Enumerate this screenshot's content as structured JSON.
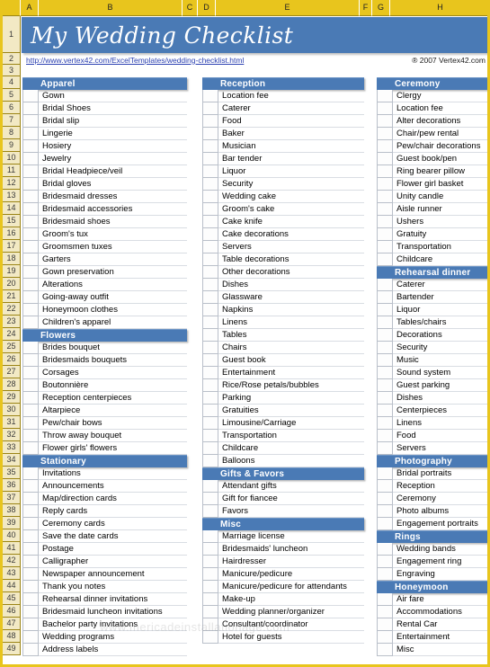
{
  "spreadsheet": {
    "column_headers": [
      {
        "label": "",
        "width": 20
      },
      {
        "label": "A",
        "width": 20
      },
      {
        "label": "B",
        "width": 160
      },
      {
        "label": "C",
        "width": 17
      },
      {
        "label": "D",
        "width": 20
      },
      {
        "label": "E",
        "width": 160
      },
      {
        "label": "F",
        "width": 14
      },
      {
        "label": "G",
        "width": 20
      },
      {
        "label": "H",
        "width": 112
      }
    ],
    "row_numbers": [
      1,
      2,
      3,
      4,
      5,
      6,
      7,
      8,
      9,
      10,
      11,
      12,
      13,
      14,
      15,
      16,
      17,
      18,
      19,
      20,
      21,
      22,
      23,
      24,
      25,
      26,
      27,
      28,
      29,
      30,
      31,
      32,
      33,
      34,
      35,
      36,
      37,
      38,
      39,
      40,
      41,
      42,
      43,
      44,
      45,
      46,
      47,
      48,
      49
    ],
    "colors": {
      "header_fill": "#e8c51d",
      "section_blue": "#4a7ab5",
      "row_header_fill": "#f2e9c4",
      "link_blue": "#2a3fb0"
    }
  },
  "title": "My Wedding Checklist",
  "link": "http://www.vertex42.com/ExcelTemplates/wedding-checklist.html",
  "copyright": "® 2007 Vertex42.com",
  "watermark": "www.mericadeinstallationage.com",
  "columns": [
    {
      "name": "column-left",
      "blocks": [
        {
          "type": "section",
          "label": "Apparel"
        },
        {
          "type": "items",
          "items": [
            "Gown",
            "Bridal Shoes",
            "Bridal slip",
            "Lingerie",
            "Hosiery",
            "Jewelry",
            "Bridal Headpiece/veil",
            "Bridal gloves",
            "Bridesmaid dresses",
            "Bridesmaid accessories",
            "Bridesmaid shoes",
            "Groom's tux",
            "Groomsmen tuxes",
            "Garters",
            "Gown preservation",
            "Alterations",
            "Going-away outfit",
            "Honeymoon clothes",
            "Children's apparel"
          ]
        },
        {
          "type": "section",
          "label": "Flowers"
        },
        {
          "type": "items",
          "items": [
            "Brides bouquet",
            "Bridesmaids bouquets",
            "Corsages",
            "Boutonnière",
            "Reception centerpieces",
            "Altarpiece",
            "Pew/chair bows",
            "Throw away bouquet",
            "Flower girls' flowers"
          ]
        },
        {
          "type": "section",
          "label": "Stationary"
        },
        {
          "type": "items",
          "items": [
            "Invitations",
            "Announcements",
            "Map/direction cards",
            "Reply cards",
            "Ceremony cards",
            "Save the date cards",
            "Postage",
            "Calligrapher",
            "Newspaper announcement",
            "Thank you notes",
            "Rehearsal dinner invitations",
            "Bridesmaid luncheon invitations",
            "Bachelor party invitations",
            "Wedding programs",
            "Address labels"
          ]
        }
      ]
    },
    {
      "name": "column-middle",
      "blocks": [
        {
          "type": "section",
          "label": "Reception"
        },
        {
          "type": "items",
          "items": [
            "Location fee",
            "Caterer",
            "Food",
            "Baker",
            "Musician",
            "Bar tender",
            "Liquor",
            "Security",
            "Wedding cake",
            "Groom's cake",
            "Cake knife",
            "Cake decorations",
            "Servers",
            "Table decorations",
            "Other decorations",
            "Dishes",
            "Glassware",
            "Napkins",
            "Linens",
            "Tables",
            "Chairs",
            "Guest book",
            "Entertainment",
            "Rice/Rose petals/bubbles",
            "Parking",
            "Gratuities",
            "Limousine/Carriage",
            "Transportation",
            "Childcare",
            "Balloons"
          ]
        },
        {
          "type": "section",
          "label": "Gifts & Favors"
        },
        {
          "type": "items",
          "items": [
            "Attendant gifts",
            "Gift for fiancee",
            "Favors"
          ]
        },
        {
          "type": "section",
          "label": "Misc"
        },
        {
          "type": "items",
          "items": [
            "Marriage license",
            "Bridesmaids' luncheon",
            "Hairdresser",
            "Manicure/pedicure",
            "Manicure/pedicure for attendants",
            "Make-up",
            "Wedding planner/organizer",
            "Consultant/coordinator",
            "Hotel for guests"
          ]
        }
      ]
    },
    {
      "name": "column-right",
      "blocks": [
        {
          "type": "section",
          "label": "Ceremony"
        },
        {
          "type": "items",
          "items": [
            "Clergy",
            "Location fee",
            "Alter decorations",
            "Chair/pew rental",
            "Pew/chair decorations",
            "Guest book/pen",
            "Ring bearer pillow",
            "Flower girl basket",
            "Unity candle",
            "Aisle runner",
            "Ushers",
            "Gratuity",
            "Transportation",
            "Childcare"
          ]
        },
        {
          "type": "section",
          "label": "Rehearsal dinner"
        },
        {
          "type": "items",
          "items": [
            "Caterer",
            "Bartender",
            "Liquor",
            "Tables/chairs",
            "Decorations",
            "Security",
            "Music",
            "Sound system",
            "Guest parking",
            "Dishes",
            "Centerpieces",
            "Linens",
            "Food",
            "Servers"
          ]
        },
        {
          "type": "section",
          "label": "Photography"
        },
        {
          "type": "items",
          "items": [
            "Bridal portraits",
            "Reception",
            "Ceremony",
            "Photo albums",
            "Engagement portraits"
          ]
        },
        {
          "type": "section",
          "label": "Rings"
        },
        {
          "type": "items",
          "items": [
            "Wedding bands",
            "Engagement ring",
            "Engraving"
          ]
        },
        {
          "type": "section",
          "label": "Honeymoon"
        },
        {
          "type": "items",
          "items": [
            "Air fare",
            "Accommodations",
            "Rental Car",
            "Entertainment",
            "Misc"
          ]
        }
      ]
    }
  ]
}
